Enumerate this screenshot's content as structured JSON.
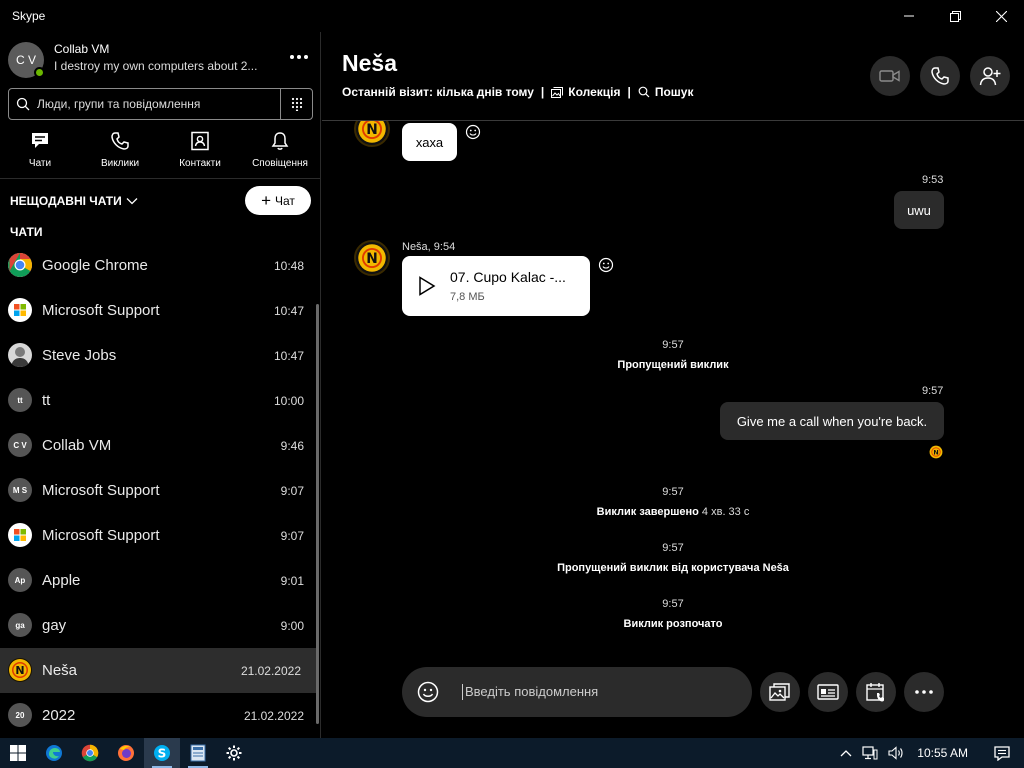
{
  "window": {
    "title": "Skype"
  },
  "profile": {
    "initials": "C V",
    "name": "Collab VM",
    "status": "I destroy my own computers about 2..."
  },
  "search": {
    "placeholder": "Люди, групи та повідомлення"
  },
  "nav": [
    {
      "label": "Чати",
      "icon": "chat-icon"
    },
    {
      "label": "Виклики",
      "icon": "phone-icon"
    },
    {
      "label": "Контакти",
      "icon": "contacts-icon"
    },
    {
      "label": "Сповіщення",
      "icon": "bell-icon"
    }
  ],
  "recent_label": "НЕЩОДАВНІ ЧАТИ",
  "new_chat_label": "Чат",
  "chats_heading": "ЧАТИ",
  "chats": [
    {
      "name": "Google Chrome",
      "time": "10:48",
      "avatar": "chrome"
    },
    {
      "name": "Microsoft Support",
      "time": "10:47",
      "avatar": "microsoft"
    },
    {
      "name": "Steve Jobs",
      "time": "10:47",
      "avatar": "photo"
    },
    {
      "name": "tt",
      "time": "10:00",
      "avatar": "tt"
    },
    {
      "name": "Collab VM",
      "time": "9:46",
      "avatar": "C V"
    },
    {
      "name": "Microsoft Support",
      "time": "9:07",
      "avatar": "M S"
    },
    {
      "name": "Microsoft Support",
      "time": "9:07",
      "avatar": "microsoft"
    },
    {
      "name": "Apple",
      "time": "9:01",
      "avatar": "Ap"
    },
    {
      "name": "gay",
      "time": "9:00",
      "avatar": "ga"
    },
    {
      "name": "Neša",
      "time": "21.02.2022",
      "avatar": "nesa"
    },
    {
      "name": "2022",
      "time": "21.02.2022",
      "avatar": "20"
    }
  ],
  "conversation": {
    "title": "Neša",
    "last_seen": "Останній візит: кілька днів тому",
    "collection": "Колекція",
    "search": "Пошук",
    "messages": {
      "m1_text": "хаха",
      "m2_time": "9:53",
      "m2_text": "uwu",
      "m3_meta": "Neša, 9:54",
      "m3_file_name": "07. Cupo Kalac -...",
      "m3_file_size": "7,8 МБ",
      "s1_time": "9:57",
      "s1_text": "Пропущений виклик",
      "m4_time": "9:57",
      "m4_text": "Give me a call when you're back.",
      "s2_time": "9:57",
      "s2_text": "Виклик завершено",
      "s2_duration": "4 хв. 33 с",
      "s3_time": "9:57",
      "s3_text": "Пропущений виклик від користувача Neša",
      "s4_time": "9:57",
      "s4_text": "Виклик розпочато"
    },
    "composer_placeholder": "Введіть повідомлення"
  },
  "taskbar": {
    "time": "10:55 AM"
  },
  "colors": {
    "accent_online": "#6bb700",
    "nesa_avatar": "#f2b800"
  }
}
